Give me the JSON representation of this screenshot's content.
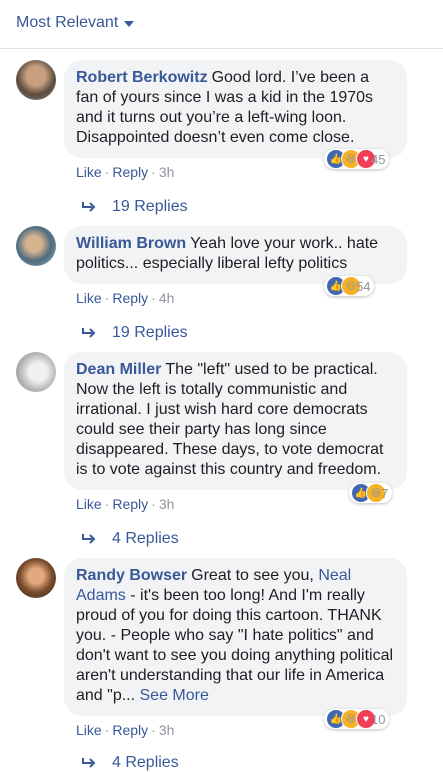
{
  "sort": {
    "label": "Most Relevant"
  },
  "comments": [
    {
      "author": "Robert Berkowitz",
      "text": "Good lord. I’ve been a fan of yours since I was a kid in the 1970s and it turns out you’re a left-wing loon. Disappointed doesn’t even come close.",
      "reactions": {
        "icons": [
          "like-icon",
          "haha-icon",
          "love-icon"
        ],
        "count": "45"
      },
      "like": "Like",
      "reply": "Reply",
      "time": "3h",
      "replies": "19 Replies"
    },
    {
      "author": "William Brown",
      "text": "Yeah love your work.. hate politics... especially liberal lefty politics",
      "reactions": {
        "icons": [
          "like-icon",
          "sad-icon"
        ],
        "count": "54"
      },
      "like": "Like",
      "reply": "Reply",
      "time": "4h",
      "replies": "19 Replies"
    },
    {
      "author": "Dean Miller",
      "text": "The \"left\" used to be practical. Now the left is totally communistic and irrational. I just wish hard core democrats could see their party has long since disappeared. These days, to vote democrat is to vote against this country and freedom.",
      "reactions": {
        "icons": [
          "like-icon",
          "haha-icon"
        ],
        "count": "7"
      },
      "like": "Like",
      "reply": "Reply",
      "time": "3h",
      "replies": "4 Replies"
    },
    {
      "author": "Randy Bowser",
      "text_before": "Great to see you, ",
      "mention": "Neal Adams",
      "text_after": " - it's been too long! And I'm really proud of you for doing this cartoon. THANK you. - People who say \"I hate politics\" and don't want to see you doing anything political aren't understanding that our life in America and \"p... ",
      "see_more": "See More",
      "reactions": {
        "icons": [
          "like-icon",
          "haha-icon",
          "love-icon"
        ],
        "count": "10"
      },
      "like": "Like",
      "reply": "Reply",
      "time": "3h",
      "replies": "4 Replies"
    }
  ]
}
